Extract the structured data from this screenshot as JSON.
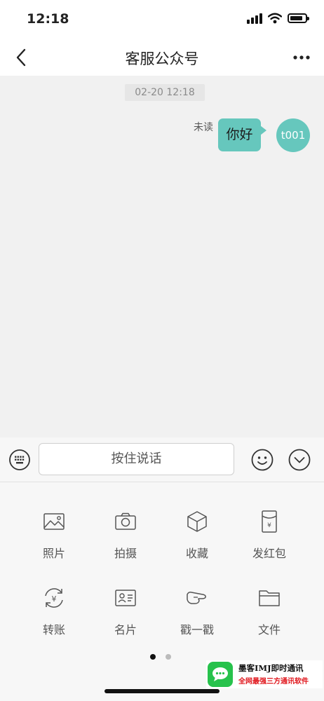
{
  "status_bar": {
    "time": "12:18"
  },
  "nav": {
    "title": "客服公众号"
  },
  "chat": {
    "timestamp": "02-20 12:18",
    "messages": [
      {
        "text": "你好",
        "status": "未读",
        "avatar_text": "t001",
        "side": "right"
      }
    ]
  },
  "input_bar": {
    "voice_label": "按住说话"
  },
  "panel": {
    "items": [
      {
        "label": "照片",
        "icon": "photo-icon"
      },
      {
        "label": "拍摄",
        "icon": "camera-icon"
      },
      {
        "label": "收藏",
        "icon": "cube-icon"
      },
      {
        "label": "发红包",
        "icon": "red-packet-icon"
      },
      {
        "label": "转账",
        "icon": "transfer-icon"
      },
      {
        "label": "名片",
        "icon": "contact-card-icon"
      },
      {
        "label": "戳一戳",
        "icon": "poke-icon"
      },
      {
        "label": "文件",
        "icon": "folder-icon"
      }
    ],
    "pages": {
      "total": 2,
      "current": 1
    }
  },
  "watermark": {
    "line1": "墨客IMJ即时通讯",
    "line2": "全网最强三方通讯软件"
  },
  "colors": {
    "accent": "#66c7bd",
    "watermark_red": "#e0161c",
    "watermark_green": "#27c24c"
  }
}
